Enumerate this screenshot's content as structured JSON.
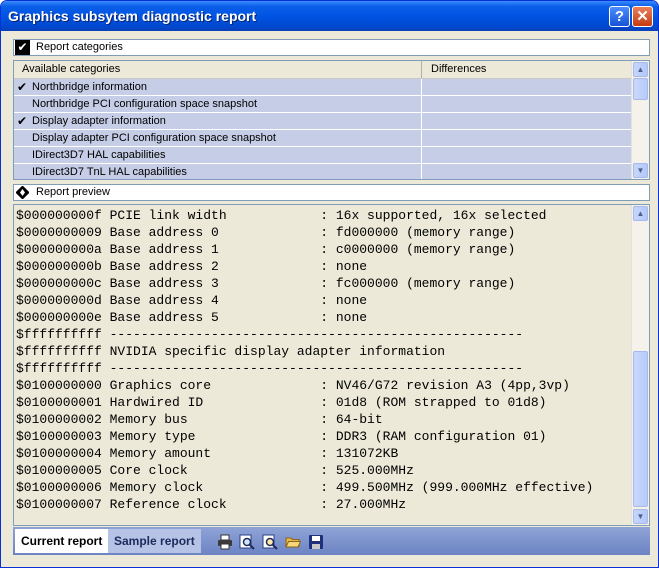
{
  "window": {
    "title": "Graphics subsytem diagnostic report",
    "help_label": "?",
    "close_label": "✕"
  },
  "categories_section": {
    "label": "Report categories",
    "checked_glyph": "✔",
    "columns": [
      "Available categories",
      "Differences"
    ],
    "items": [
      {
        "name": "Northbridge information",
        "checked": true
      },
      {
        "name": "Northbridge PCI configuration space snapshot",
        "checked": false
      },
      {
        "name": "Display adapter information",
        "checked": true
      },
      {
        "name": "Display adapter PCI configuration space snapshot",
        "checked": false
      },
      {
        "name": "IDirect3D7 HAL capabilities",
        "checked": false
      },
      {
        "name": "IDirect3D7 TnL HAL capabilities",
        "checked": false
      }
    ],
    "check_mark": "✔"
  },
  "preview_section": {
    "label": "Report preview",
    "lines": [
      "$000000000f PCIE link width            : 16x supported, 16x selected",
      "$0000000009 Base address 0             : fd000000 (memory range)",
      "$000000000a Base address 1             : c0000000 (memory range)",
      "$000000000b Base address 2             : none",
      "$000000000c Base address 3             : fc000000 (memory range)",
      "$000000000d Base address 4             : none",
      "$000000000e Base address 5             : none",
      "$ffffffffff -----------------------------------------------------",
      "$ffffffffff NVIDIA specific display adapter information",
      "$ffffffffff -----------------------------------------------------",
      "$0100000000 Graphics core              : NV46/G72 revision A3 (4pp,3vp)",
      "$0100000001 Hardwired ID               : 01d8 (ROM strapped to 01d8)",
      "$0100000002 Memory bus                 : 64-bit",
      "$0100000003 Memory type                : DDR3 (RAM configuration 01)",
      "$0100000004 Memory amount              : 131072KB",
      "$0100000005 Core clock                 : 525.000MHz",
      "$0100000006 Memory clock               : 499.500MHz (999.000MHz effective)",
      "$0100000007 Reference clock            : 27.000MHz"
    ]
  },
  "tabs": [
    {
      "label": "Current report"
    },
    {
      "label": "Sample report"
    }
  ],
  "scroll_arrows": {
    "up": "▲",
    "down": "▼"
  }
}
